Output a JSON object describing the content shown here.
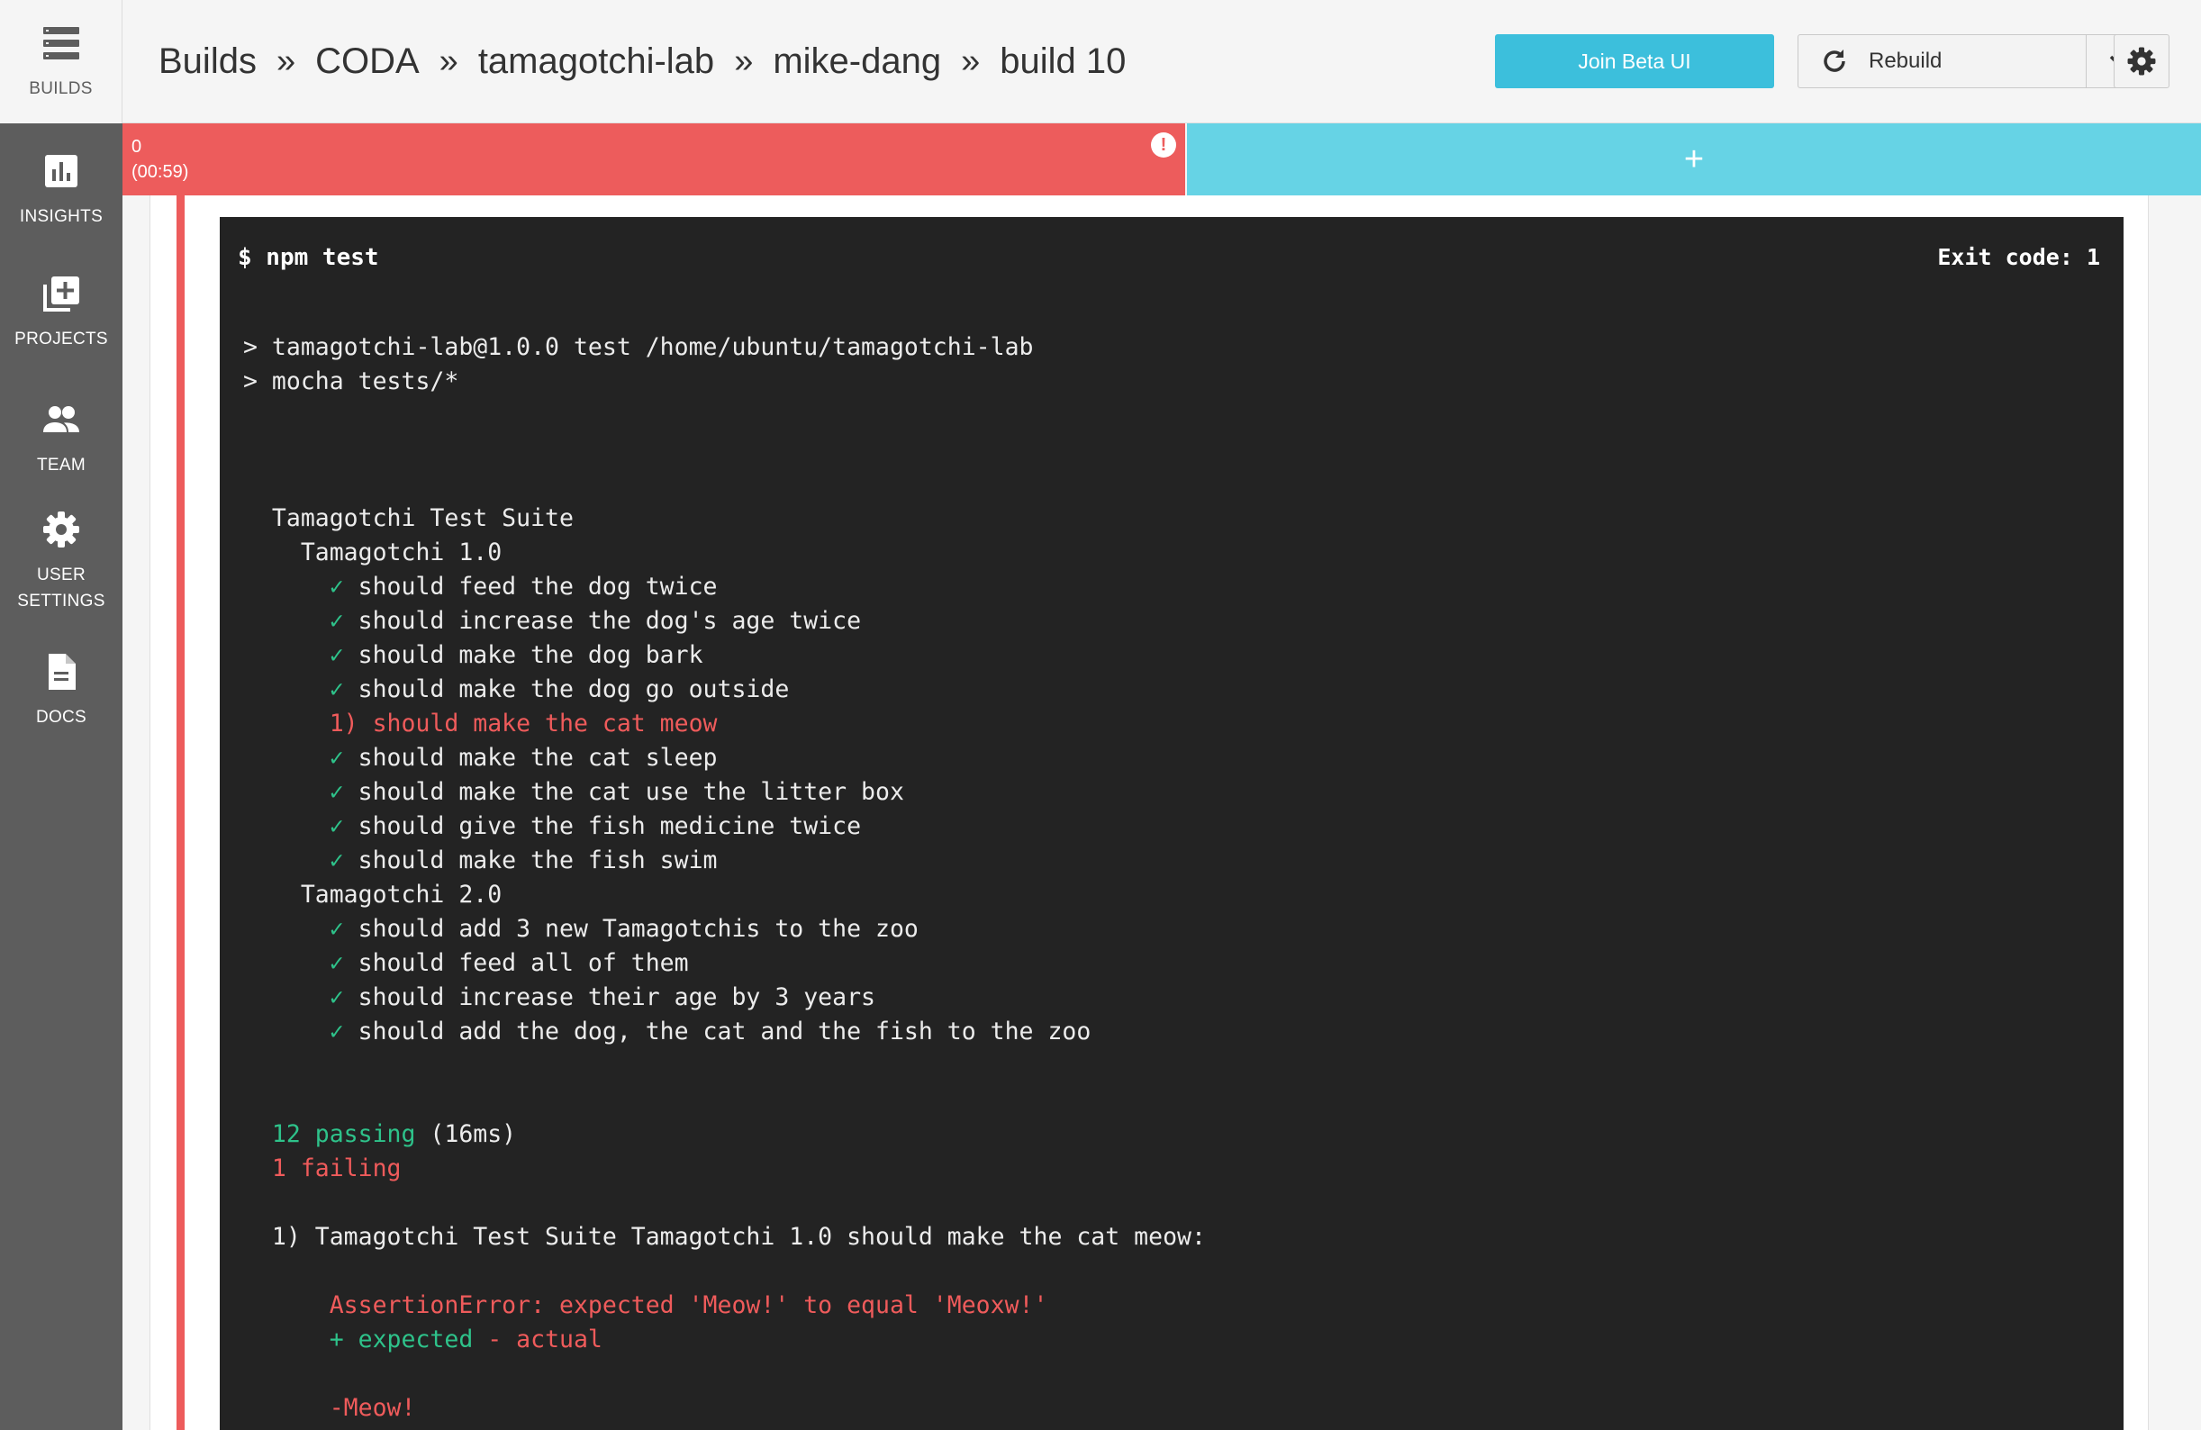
{
  "sidebar": {
    "brand_label": "BUILDS",
    "items": [
      {
        "label": "INSIGHTS",
        "icon": "insights-icon"
      },
      {
        "label": "PROJECTS",
        "icon": "projects-icon"
      },
      {
        "label": "TEAM",
        "icon": "team-icon"
      },
      {
        "label_line1": "USER",
        "label_line2": "SETTINGS",
        "icon": "gear-icon"
      },
      {
        "label": "DOCS",
        "icon": "docs-icon"
      }
    ]
  },
  "header": {
    "breadcrumb": [
      "Builds",
      "CODA",
      "tamagotchi-lab",
      "mike-dang",
      "build 10"
    ],
    "separator": "»",
    "beta_button": "Join Beta UI",
    "rebuild_button": "Rebuild"
  },
  "status": {
    "container_index": "0",
    "duration": "(00:59)",
    "alert_glyph": "!",
    "add_glyph": "+",
    "fail_color": "#ed5c5c",
    "add_color": "#66d3e5"
  },
  "terminal": {
    "command": "$ npm test",
    "exit_code": "Exit code: 1",
    "lines": [
      {
        "segs": [
          {
            "t": "> tamagotchi-lab@1.0.0 test /home/ubuntu/tamagotchi-lab",
            "c": ""
          }
        ]
      },
      {
        "segs": [
          {
            "t": "> mocha tests/*",
            "c": ""
          }
        ]
      },
      {
        "segs": [
          {
            "t": "",
            "c": ""
          }
        ]
      },
      {
        "segs": [
          {
            "t": "",
            "c": ""
          }
        ]
      },
      {
        "segs": [
          {
            "t": "",
            "c": ""
          }
        ]
      },
      {
        "segs": [
          {
            "t": "  Tamagotchi Test Suite",
            "c": ""
          }
        ]
      },
      {
        "segs": [
          {
            "t": "    Tamagotchi 1.0",
            "c": ""
          }
        ]
      },
      {
        "segs": [
          {
            "t": "      ✓",
            "c": "ok"
          },
          {
            "t": " should feed the dog twice",
            "c": ""
          }
        ]
      },
      {
        "segs": [
          {
            "t": "      ✓",
            "c": "ok"
          },
          {
            "t": " should increase the dog's age twice",
            "c": ""
          }
        ]
      },
      {
        "segs": [
          {
            "t": "      ✓",
            "c": "ok"
          },
          {
            "t": " should make the dog bark",
            "c": ""
          }
        ]
      },
      {
        "segs": [
          {
            "t": "      ✓",
            "c": "ok"
          },
          {
            "t": " should make the dog go outside",
            "c": ""
          }
        ]
      },
      {
        "segs": [
          {
            "t": "      1) should make the cat meow",
            "c": "bad"
          }
        ]
      },
      {
        "segs": [
          {
            "t": "      ✓",
            "c": "ok"
          },
          {
            "t": " should make the cat sleep",
            "c": ""
          }
        ]
      },
      {
        "segs": [
          {
            "t": "      ✓",
            "c": "ok"
          },
          {
            "t": " should make the cat use the litter box",
            "c": ""
          }
        ]
      },
      {
        "segs": [
          {
            "t": "      ✓",
            "c": "ok"
          },
          {
            "t": " should give the fish medicine twice",
            "c": ""
          }
        ]
      },
      {
        "segs": [
          {
            "t": "      ✓",
            "c": "ok"
          },
          {
            "t": " should make the fish swim",
            "c": ""
          }
        ]
      },
      {
        "segs": [
          {
            "t": "    Tamagotchi 2.0",
            "c": ""
          }
        ]
      },
      {
        "segs": [
          {
            "t": "      ✓",
            "c": "ok"
          },
          {
            "t": " should add 3 new Tamagotchis to the zoo",
            "c": ""
          }
        ]
      },
      {
        "segs": [
          {
            "t": "      ✓",
            "c": "ok"
          },
          {
            "t": " should feed all of them",
            "c": ""
          }
        ]
      },
      {
        "segs": [
          {
            "t": "      ✓",
            "c": "ok"
          },
          {
            "t": " should increase their age by 3 years",
            "c": ""
          }
        ]
      },
      {
        "segs": [
          {
            "t": "      ✓",
            "c": "ok"
          },
          {
            "t": " should add the dog, the cat and the fish to the zoo",
            "c": ""
          }
        ]
      },
      {
        "segs": [
          {
            "t": "",
            "c": ""
          }
        ]
      },
      {
        "segs": [
          {
            "t": "",
            "c": ""
          }
        ]
      },
      {
        "segs": [
          {
            "t": "  12 passing",
            "c": "ok"
          },
          {
            "t": " (16ms)",
            "c": ""
          }
        ]
      },
      {
        "segs": [
          {
            "t": "  1 failing",
            "c": "bad"
          }
        ]
      },
      {
        "segs": [
          {
            "t": "",
            "c": ""
          }
        ]
      },
      {
        "segs": [
          {
            "t": "  1) Tamagotchi Test Suite Tamagotchi 1.0 should make the cat meow:",
            "c": ""
          }
        ]
      },
      {
        "segs": [
          {
            "t": "",
            "c": ""
          }
        ]
      },
      {
        "segs": [
          {
            "t": "      AssertionError: expected 'Meow!' to equal 'Meoxw!'",
            "c": "bad"
          }
        ]
      },
      {
        "segs": [
          {
            "t": "      + expected",
            "c": "ok"
          },
          {
            "t": " ",
            "c": ""
          },
          {
            "t": "- actual",
            "c": "bad"
          }
        ]
      },
      {
        "segs": [
          {
            "t": "",
            "c": ""
          }
        ]
      },
      {
        "segs": [
          {
            "t": "      -Meow!",
            "c": "bad"
          }
        ]
      }
    ]
  }
}
